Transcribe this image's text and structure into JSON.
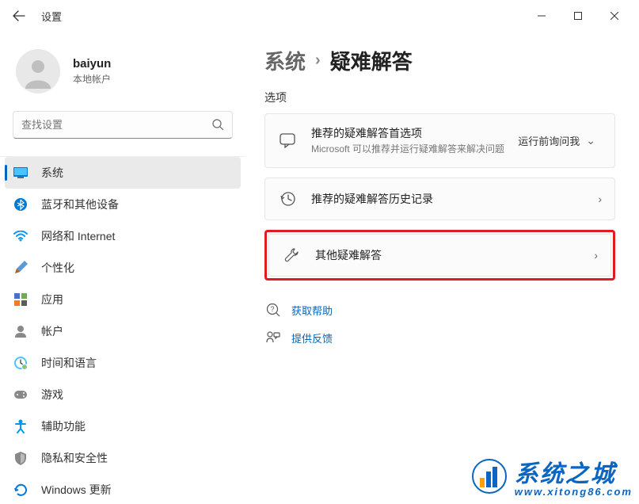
{
  "app": {
    "title": "设置"
  },
  "user": {
    "name": "baiyun",
    "sub": "本地帐户"
  },
  "search": {
    "placeholder": "查找设置"
  },
  "nav": {
    "items": [
      {
        "label": "系统",
        "icon": "system"
      },
      {
        "label": "蓝牙和其他设备",
        "icon": "bluetooth"
      },
      {
        "label": "网络和 Internet",
        "icon": "wifi"
      },
      {
        "label": "个性化",
        "icon": "personalize"
      },
      {
        "label": "应用",
        "icon": "apps"
      },
      {
        "label": "帐户",
        "icon": "accounts"
      },
      {
        "label": "时间和语言",
        "icon": "time"
      },
      {
        "label": "游戏",
        "icon": "gaming"
      },
      {
        "label": "辅助功能",
        "icon": "accessibility"
      },
      {
        "label": "隐私和安全性",
        "icon": "privacy"
      },
      {
        "label": "Windows 更新",
        "icon": "update"
      }
    ]
  },
  "breadcrumb": {
    "parent": "系统",
    "current": "疑难解答"
  },
  "section": {
    "label": "选项"
  },
  "cards": {
    "recommended": {
      "title": "推荐的疑难解答首选项",
      "sub": "Microsoft 可以推荐并运行疑难解答来解决问题",
      "action": "运行前询问我"
    },
    "history": {
      "title": "推荐的疑难解答历史记录"
    },
    "other": {
      "title": "其他疑难解答"
    }
  },
  "footer": {
    "help": "获取帮助",
    "feedback": "提供反馈"
  },
  "watermark": {
    "title": "系统之城",
    "url": "www.xitong86.com"
  }
}
